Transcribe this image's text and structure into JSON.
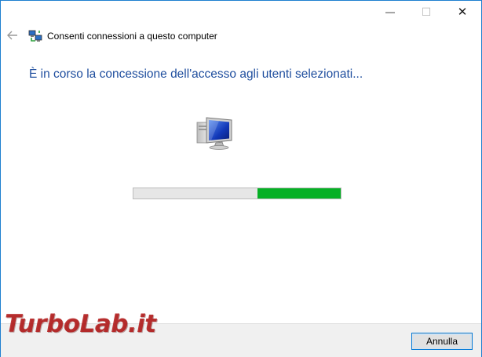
{
  "window": {
    "controls": {
      "minimize": "—",
      "maximize": "☐",
      "close": "✕"
    }
  },
  "header": {
    "icon": "network-computers-icon",
    "title": "Consenti connessioni a questo computer"
  },
  "main": {
    "instruction": "È in corso la concessione dell'accesso agli utenti selezionati...",
    "icon": "computer-icon",
    "progress": {
      "fill_start_percent": 60,
      "fill_end_percent": 100,
      "color": "#06b025"
    }
  },
  "footer": {
    "cancel_label": "Annulla"
  },
  "watermark": {
    "text": "TurboLab.it"
  },
  "colors": {
    "accent": "#0078d7",
    "instruction_text": "#1f4e9e"
  }
}
